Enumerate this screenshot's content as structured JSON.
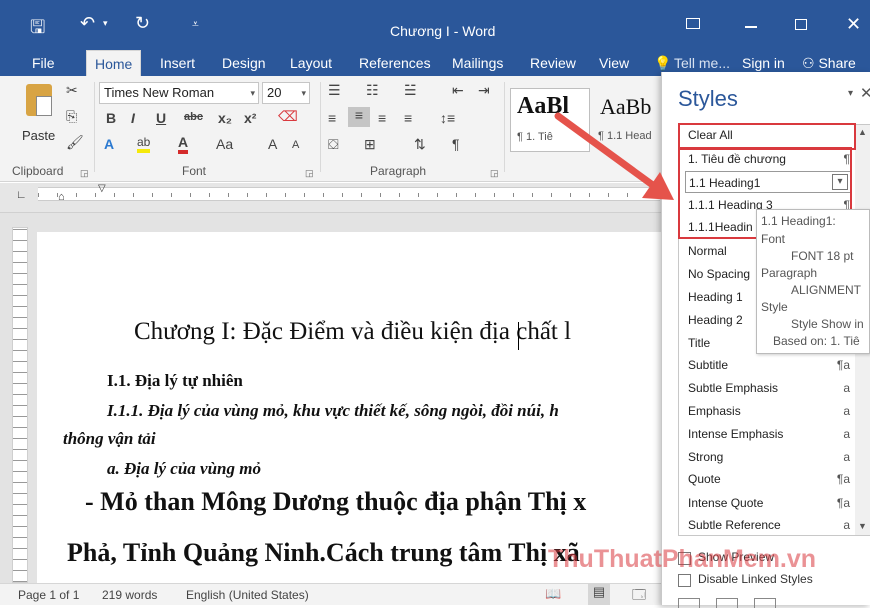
{
  "title": {
    "text": "Chương I - Word",
    "user": "Sign in",
    "tell_me": "Tell me...",
    "share": "Share"
  },
  "tabs": [
    "File",
    "Home",
    "Insert",
    "Design",
    "Layout",
    "References",
    "Mailings",
    "Review",
    "View"
  ],
  "ribbon": {
    "paste_label": "Paste",
    "font_name": "Times New Roman",
    "font_size": "20",
    "bold": "B",
    "italic": "I",
    "underline": "U",
    "strike": "abc",
    "sub": "x₂",
    "sup": "x²",
    "changecase": "Aa",
    "grow": "A",
    "shrink": "A",
    "style_preview_1": "AaBl",
    "style_preview_1_name": "¶ 1. Tiê",
    "style_preview_2": "AaBb",
    "style_preview_2_name": "¶ 1.1 Head",
    "groups": {
      "clipboard": "Clipboard",
      "font": "Font",
      "paragraph": "Paragraph"
    }
  },
  "document": {
    "line1": "Chương I: Đặc Điểm và điều kiện địa chất l",
    "line2": "I.1. Địa lý tự  nhiên",
    "line3": "I.1.1. Địa lý của vùng mỏ, khu vực thiết kế, sông ngòi, đồi núi, h",
    "line4": "thông vận tải",
    "line5": "a. Địa lý của vùng mỏ",
    "line6": "- Mỏ than Mông Dương thuộc địa phận Thị x",
    "line7": "Phả, Tỉnh Quảng Ninh.Cách trung tâm Thị xã"
  },
  "status": {
    "page": "Page 1 of 1",
    "words": "219 words",
    "language": "English (United States)"
  },
  "styles_pane": {
    "title": "Styles",
    "items": [
      {
        "label": "Clear All",
        "mark": ""
      },
      {
        "label": "1. Tiêu đề chương",
        "mark": "¶"
      },
      {
        "label": "1.1 Heading1",
        "mark": "▾"
      },
      {
        "label": "1.1.1 Heading 3",
        "mark": "¶"
      },
      {
        "label": "1.1.1Headin",
        "mark": ""
      },
      {
        "label": "Normal",
        "mark": ""
      },
      {
        "label": "No Spacing",
        "mark": ""
      },
      {
        "label": "Heading 1",
        "mark": ""
      },
      {
        "label": "Heading 2",
        "mark": ""
      },
      {
        "label": "Title",
        "mark": ""
      },
      {
        "label": "Subtitle",
        "mark": "¶a"
      },
      {
        "label": "Subtle Emphasis",
        "mark": "a"
      },
      {
        "label": "Emphasis",
        "mark": "a"
      },
      {
        "label": "Intense Emphasis",
        "mark": "a"
      },
      {
        "label": "Strong",
        "mark": "a"
      },
      {
        "label": "Quote",
        "mark": "¶a"
      },
      {
        "label": "Intense Quote",
        "mark": "¶a"
      },
      {
        "label": "Subtle Reference",
        "mark": "a"
      }
    ],
    "show_preview": "Show Preview",
    "disable_linked": "Disable Linked Styles"
  },
  "tooltip": {
    "title": "1.1 Heading1:",
    "font_label": "Font",
    "font_value": "FONT  18 pt",
    "para_label": "Paragraph",
    "para_value": "ALIGNMENT",
    "style_label": "Style",
    "style_value": "Style Show in",
    "based_on": "Based on: 1. Tiê"
  },
  "watermark": "ThuThuatPhanMem.vn",
  "colors": {
    "accent": "#2b579a",
    "highlight": "#d9393e",
    "arrow": "#e5534b"
  }
}
